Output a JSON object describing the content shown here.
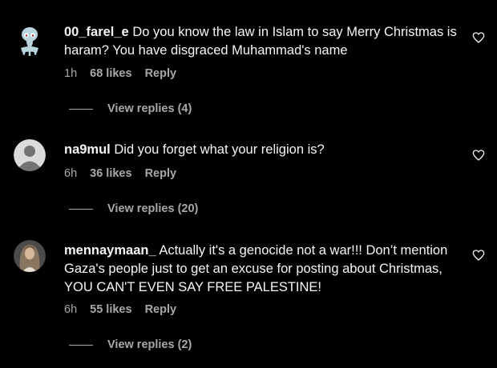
{
  "comments": [
    {
      "username": "00_farel_e",
      "text": "Do you know the law in Islam to say Merry Christmas is haram? You have disgraced Muhammad's name",
      "time": "1h",
      "likes": "68 likes",
      "reply_label": "Reply",
      "view_replies": "View replies (4)",
      "avatar": "squidward-avatar"
    },
    {
      "username": "na9mul",
      "text": "Did you forget what your religion is?",
      "time": "6h",
      "likes": "36 likes",
      "reply_label": "Reply",
      "view_replies": "View replies (20)",
      "avatar": "default-avatar"
    },
    {
      "username": "mennaymaan_",
      "text": "Actually it's a genocide not a war!!! Don’t mention Gaza's people just to get an excuse for posting about Christmas, YOU CAN'T EVEN SAY FREE PALESTINE!",
      "time": "6h",
      "likes": "55 likes",
      "reply_label": "Reply",
      "view_replies": "View replies (2)",
      "avatar": "photo-avatar"
    }
  ],
  "colors": {
    "background": "#000000",
    "text": "#f5f5f5",
    "secondary": "#a8a8a8"
  }
}
